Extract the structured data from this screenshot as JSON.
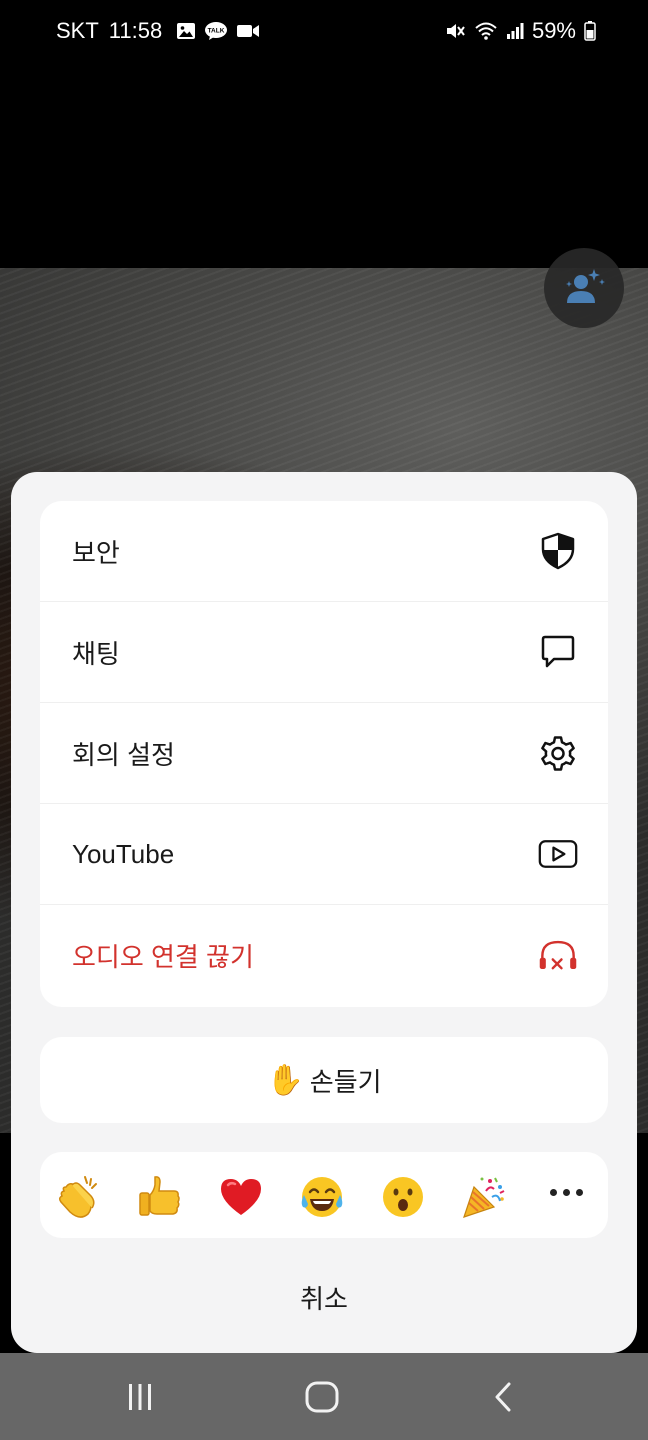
{
  "status_bar": {
    "carrier": "SKT",
    "time": "11:58",
    "battery": "59%",
    "left_icons": [
      "image-icon",
      "kakaotalk-icon",
      "video-camera-icon"
    ],
    "kakaotalk_label": "TALK",
    "right_icons": [
      "mute-icon",
      "wifi-icon",
      "signal-icon",
      "battery-icon"
    ]
  },
  "menu": {
    "items": [
      {
        "label": "보안",
        "icon": "shield-icon"
      },
      {
        "label": "채팅",
        "icon": "chat-bubble-icon"
      },
      {
        "label": "회의 설정",
        "icon": "gear-icon"
      },
      {
        "label": "YouTube",
        "icon": "youtube-play-icon"
      },
      {
        "label": "오디오 연결 끊기",
        "icon": "headphones-disconnect-icon",
        "danger": true
      }
    ]
  },
  "raise_hand": {
    "emoji": "✋",
    "label": "손들기"
  },
  "reactions": {
    "items": [
      {
        "name": "clapping-hands",
        "emoji": "👏"
      },
      {
        "name": "thumbs-up",
        "emoji": "👍"
      },
      {
        "name": "red-heart",
        "emoji": "❤️"
      },
      {
        "name": "tears-of-joy",
        "emoji": "😂"
      },
      {
        "name": "surprised-face",
        "emoji": "😮"
      },
      {
        "name": "party-popper",
        "emoji": "🎉"
      }
    ],
    "more_icon": "more-horizontal-icon"
  },
  "cancel_label": "취소",
  "colors": {
    "danger": "#d2322d",
    "sheet_bg": "#f4f4f5",
    "nav_bar": "#676767"
  }
}
